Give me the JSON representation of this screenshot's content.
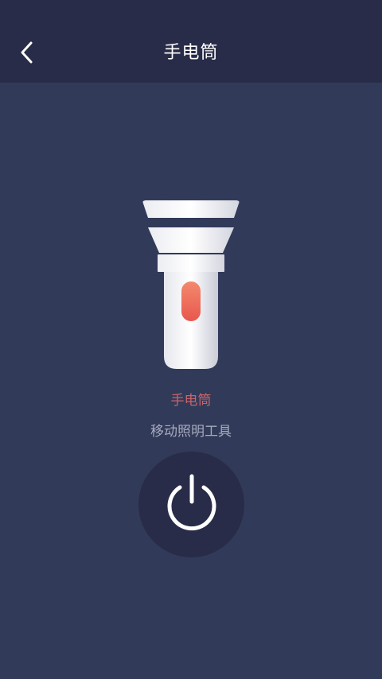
{
  "header": {
    "title": "手电筒",
    "back_icon": "chevron-left-icon"
  },
  "tool": {
    "name": "手电筒",
    "description": "移动照明工具",
    "illustration_icon": "flashlight-icon",
    "power_icon": "power-icon"
  },
  "colors": {
    "background": "#313a59",
    "header": "#282c48",
    "accent_red": "#c8646a",
    "text_muted": "#a7abbe"
  }
}
